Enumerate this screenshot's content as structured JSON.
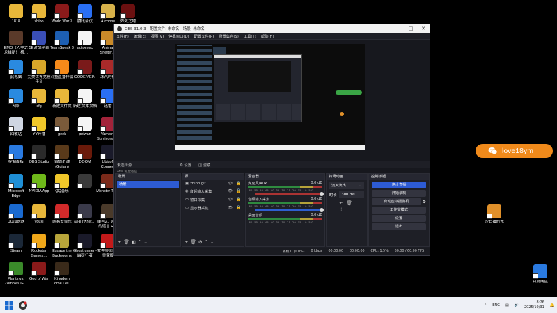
{
  "desktop": {
    "icons": [
      {
        "label": "1818",
        "name": "folder-icon",
        "color": "#e8b73a"
      },
      {
        "label": "zhibo",
        "name": "folder-icon",
        "color": "#e8b73a"
      },
      {
        "label": "World War Z",
        "name": "world-war-z-icon",
        "color": "#8b1a1a"
      },
      {
        "label": "腾讯会议",
        "name": "tencent-meeting-icon",
        "color": "#2a6ff3"
      },
      {
        "label": "Archons",
        "name": "archons-icon",
        "color": "#d7b24a"
      },
      {
        "label": "殊死之地",
        "name": "game-icon",
        "color": "#6b1010"
      },
      {
        "label": "EMO《人中之龙维新！ 极…",
        "name": "emo-game-icon",
        "color": "#5a3a2a"
      },
      {
        "label": "5E对战平台",
        "name": "5e-platform-icon",
        "color": "#3a4fb8"
      },
      {
        "label": "TeamSpeak 3",
        "name": "teamspeak-icon",
        "color": "#1d5fb3"
      },
      {
        "label": "autoexec",
        "name": "file-icon",
        "color": "#f4f4f4"
      },
      {
        "label": "Animal Shelter…",
        "name": "animal-shelter-icon",
        "color": "#c98a2a"
      },
      {
        "label": "此电脑",
        "name": "this-pc-icon",
        "color": "#2a8ae0"
      },
      {
        "label": "完美世界竞技平台",
        "name": "perfect-world-icon",
        "color": "#d8a72a"
      },
      {
        "label": "斗鱼直播伴侣",
        "name": "douyu-icon",
        "color": "#f58a1a"
      },
      {
        "label": "CODE VEIN",
        "name": "code-vein-icon",
        "color": "#7a1a1a"
      },
      {
        "label": "冰汽时代",
        "name": "frostpunk-icon",
        "color": "#aa2a2a"
      },
      {
        "label": "网络",
        "name": "network-icon",
        "color": "#2a8ae0"
      },
      {
        "label": "cfg",
        "name": "folder-icon",
        "color": "#e8b73a"
      },
      {
        "label": "新建文件夹",
        "name": "folder-icon",
        "color": "#e8b73a"
      },
      {
        "label": "新建 文本文档",
        "name": "text-document-icon",
        "color": "#f4f4f4"
      },
      {
        "label": "迅雷",
        "name": "xunlei-icon",
        "color": "#2a6ff3"
      },
      {
        "label": "回收站",
        "name": "recycle-bin-icon",
        "color": "#cfd6e2"
      },
      {
        "label": "YY开播",
        "name": "yy-live-icon",
        "color": "#f0c72a"
      },
      {
        "label": "geek",
        "name": "geek-icon",
        "color": "#7a5a3a"
      },
      {
        "label": "peiwan",
        "name": "file-icon",
        "color": "#f4f4f4"
      },
      {
        "label": "Vampire Survivors -…",
        "name": "vampire-survivors-icon",
        "color": "#a2233a"
      },
      {
        "label": "控制面板",
        "name": "control-panel-icon",
        "color": "#2a7ae0"
      },
      {
        "label": "OBS Studio",
        "name": "obs-studio-icon",
        "color": "#2a2a2a"
      },
      {
        "label": "古剑奇谭 (Gujian)",
        "name": "gujian-icon",
        "color": "#5a3a1a"
      },
      {
        "label": "DOOM",
        "name": "doom-icon",
        "color": "#6a1a0a"
      },
      {
        "label": "Ubisoft Connect",
        "name": "ubisoft-icon",
        "color": "#1a1a2a"
      },
      {
        "label": "Microsoft Edge",
        "name": "edge-icon",
        "color": "#1f8fd6"
      },
      {
        "label": "NVIDIA App",
        "name": "nvidia-icon",
        "color": "#6fb81a"
      },
      {
        "label": "QQ音乐",
        "name": "qq-music-icon",
        "color": "#f0c72a"
      },
      {
        "label": "",
        "name": "game-icon",
        "color": "#3a3a3a"
      },
      {
        "label": "Monster Train",
        "name": "monster-train-icon",
        "color": "#7a2a1a"
      },
      {
        "label": "UU加速器",
        "name": "uu-accelerator-icon",
        "color": "#1a6ad0"
      },
      {
        "label": "youxi",
        "name": "folder-icon",
        "color": "#e8b73a"
      },
      {
        "label": "网易云音乐",
        "name": "netease-music-icon",
        "color": "#d22a2a"
      },
      {
        "label": "剑星(信仰:…",
        "name": "stellar-blade-icon",
        "color": "#3a3a4a"
      },
      {
        "label": "审判2：死神的遗言 R…",
        "name": "judgment-icon",
        "color": "#4a3a2a"
      },
      {
        "label": "Steam",
        "name": "steam-icon",
        "color": "#1b2838"
      },
      {
        "label": "Rockstar Games…",
        "name": "rockstar-icon",
        "color": "#f0a81a"
      },
      {
        "label": "Escape the Backrooms",
        "name": "escape-backrooms-icon",
        "color": "#b8a53a"
      },
      {
        "label": "Ghostrunner - 幽灵行者",
        "name": "ghostrunner-icon",
        "color": "#1a1a2a"
      },
      {
        "label": "女神异闻录5 皇家版",
        "name": "persona5-icon",
        "color": "#c21a1a"
      },
      {
        "label": "Plants vs. Zombies G…",
        "name": "pvz-icon",
        "color": "#3a8a2a"
      },
      {
        "label": "God of War",
        "name": "god-of-war-icon",
        "color": "#8a1a1a"
      },
      {
        "label": "Kingdom Come Del…",
        "name": "kingdom-come-icon",
        "color": "#3a2a1a"
      }
    ],
    "right_icons": [
      {
        "label": "沙石镇时光",
        "name": "sandrock-icon",
        "color": "#e0902a"
      },
      {
        "label": "百度网盘",
        "name": "baidu-netdisk-icon",
        "color": "#2a7ae0"
      }
    ]
  },
  "obs": {
    "title": "OBS 31.0.3 - 配置文件: 未命名 - 场景: 未命名",
    "menu": [
      "文件(F)",
      "编辑(E)",
      "视图(V)",
      "停靠窗口(D)",
      "配置文件(P)",
      "场景集合(S)",
      "工具(T)",
      "帮助(H)"
    ],
    "zoom": "34%  缩放适应",
    "no_source": "未选择源",
    "properties": "⚙ 设置",
    "filters": "◫ 滤镜",
    "scenes": {
      "title": "场景",
      "items": [
        "场景"
      ]
    },
    "sources": {
      "title": "源",
      "items": [
        "zhibo.gif",
        "音频输入采集",
        "窗口采集",
        "显示器采集"
      ]
    },
    "mixer": {
      "title": "混音器",
      "channels": [
        {
          "name": "麦克风/Aux",
          "db": "0.0 dB"
        },
        {
          "name": "音频输入采集",
          "db": "0.0 dB"
        },
        {
          "name": "桌面音频",
          "db": "0.0 dB"
        }
      ],
      "ticks": "-60 -55 -50 -45 -40 -35 -30 -25 -20 -15 -10 -5 0"
    },
    "transitions": {
      "title": "转场动画",
      "selected": "淡入淡出",
      "duration_label": "时长",
      "duration": "300 ms"
    },
    "controls": {
      "title": "控制按钮",
      "buttons": [
        "停止直播",
        "开始录制",
        "启动虚拟摄像机",
        "工作室模式",
        "设置",
        "退出"
      ]
    },
    "status": {
      "dropped": "丢帧 0 (0.0%)",
      "bitrate": "0 kbps",
      "rec_time": "00:00:00",
      "live_time": "00:00:00",
      "cpu": "CPU: 1.5%",
      "fps": "60.00 / 60.00 FPS"
    }
  },
  "chip": {
    "label": "love18ym",
    "color": "#f08a1b"
  },
  "taskbar": {
    "items": [
      "windows-start-icon",
      "obs-studio-icon"
    ],
    "tray": {
      "lang": "ENG",
      "time": "8:26",
      "date": "2025/10/31"
    }
  }
}
